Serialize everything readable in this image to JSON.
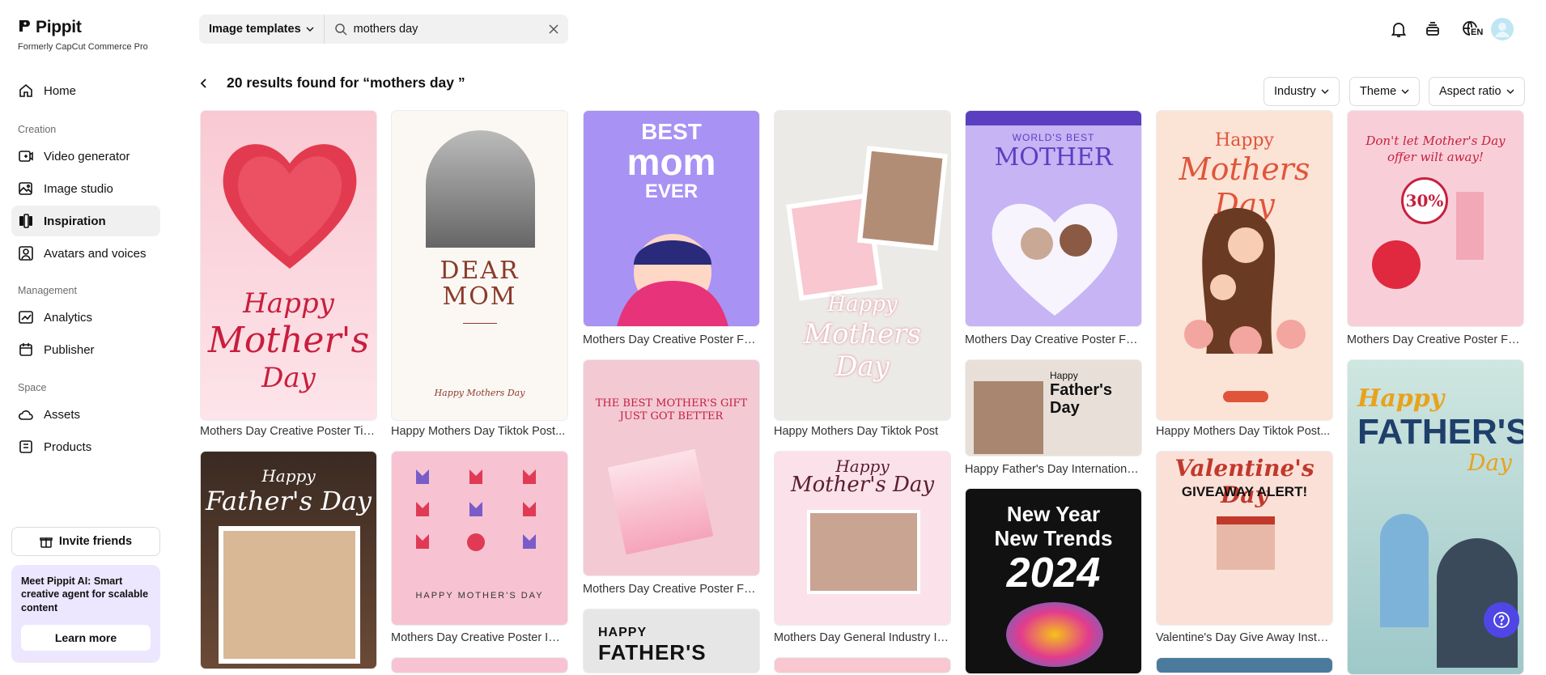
{
  "brand": {
    "name": "Pippit",
    "subtitle": "Formerly CapCut Commerce Pro"
  },
  "sidebar": {
    "home": "Home",
    "sections": {
      "creation": "Creation",
      "management": "Management",
      "space": "Space"
    },
    "creation_items": [
      "Video generator",
      "Image studio",
      "Inspiration",
      "Avatars and voices"
    ],
    "management_items": [
      "Analytics",
      "Publisher"
    ],
    "space_items": [
      "Assets",
      "Products"
    ],
    "active": "Inspiration",
    "invite_label": "Invite friends",
    "promo": {
      "text": "Meet Pippit AI: Smart creative agent for scalable content",
      "button": "Learn more"
    }
  },
  "search": {
    "category": "Image templates",
    "query": "mothers day"
  },
  "header": {
    "lang": "EN"
  },
  "results": {
    "title": "20 results found for “mothers day ”",
    "filters": [
      "Industry",
      "Theme",
      "Aspect ratio"
    ]
  },
  "cards": [
    {
      "caption": "Mothers Day Creative Poster Tik...",
      "art": [
        "Happy",
        "Mother's",
        "Day"
      ]
    },
    {
      "caption": "Mothers Day Creative Poster FB...",
      "art": [
        "BEST",
        "mom",
        "EVER"
      ]
    },
    {
      "caption": "Happy Mothers Day Tiktok Post...",
      "art": [
        "DEAR",
        "MOM",
        "Happy Mothers Day"
      ]
    },
    {
      "caption": "Happy Mothers Day Tiktok Post",
      "art": [
        "Happy",
        "Mothers Day"
      ]
    },
    {
      "caption": "Mothers Day Creative Poster FB...",
      "art": [
        "WORLD'S BEST",
        "MOTHER"
      ]
    },
    {
      "caption": "Happy Mothers Day Tiktok Post...",
      "art": [
        "Happy",
        "Mothers Day"
      ]
    },
    {
      "caption": "Mothers Day Creative Poster FB...",
      "art": [
        "Don't let Mother's Day",
        "offer wilt away!",
        "30%"
      ]
    },
    {
      "caption": "Mothers Day Creative Poster FB...",
      "art": [
        "THE BEST MOTHER'S GIFT",
        "JUST GOT BETTER"
      ]
    },
    {
      "caption": "Happy Father's Day Internationa...",
      "art": [
        "Happy",
        "Father's",
        "Day"
      ]
    },
    {
      "caption": "Mothers Day Creative Poster IG ...",
      "art": [
        "HAPPY MOTHER'S DAY"
      ]
    },
    {
      "caption": "Mothers Day General Industry In...",
      "art": [
        "Happy",
        "Mother's Day"
      ]
    },
    {
      "caption": "Valentine's Day Give Away Insta...",
      "art": [
        "Valentine's Day",
        "GIVEAWAY ALERT!"
      ]
    },
    {
      "caption": "",
      "art": [
        "Happy",
        "Father's Day"
      ]
    },
    {
      "caption": "",
      "art": [
        "New Year",
        "New Trends",
        "2024"
      ]
    },
    {
      "caption": "",
      "art": [
        "Happy",
        "FATHER'S",
        "Day"
      ]
    },
    {
      "caption": "",
      "art": [
        "HAPPY",
        "FATHER'S"
      ]
    }
  ],
  "colors": {
    "accent": "#4f46e5",
    "active_bg": "#f0f0f0",
    "promo_bg": "#ece6ff"
  }
}
